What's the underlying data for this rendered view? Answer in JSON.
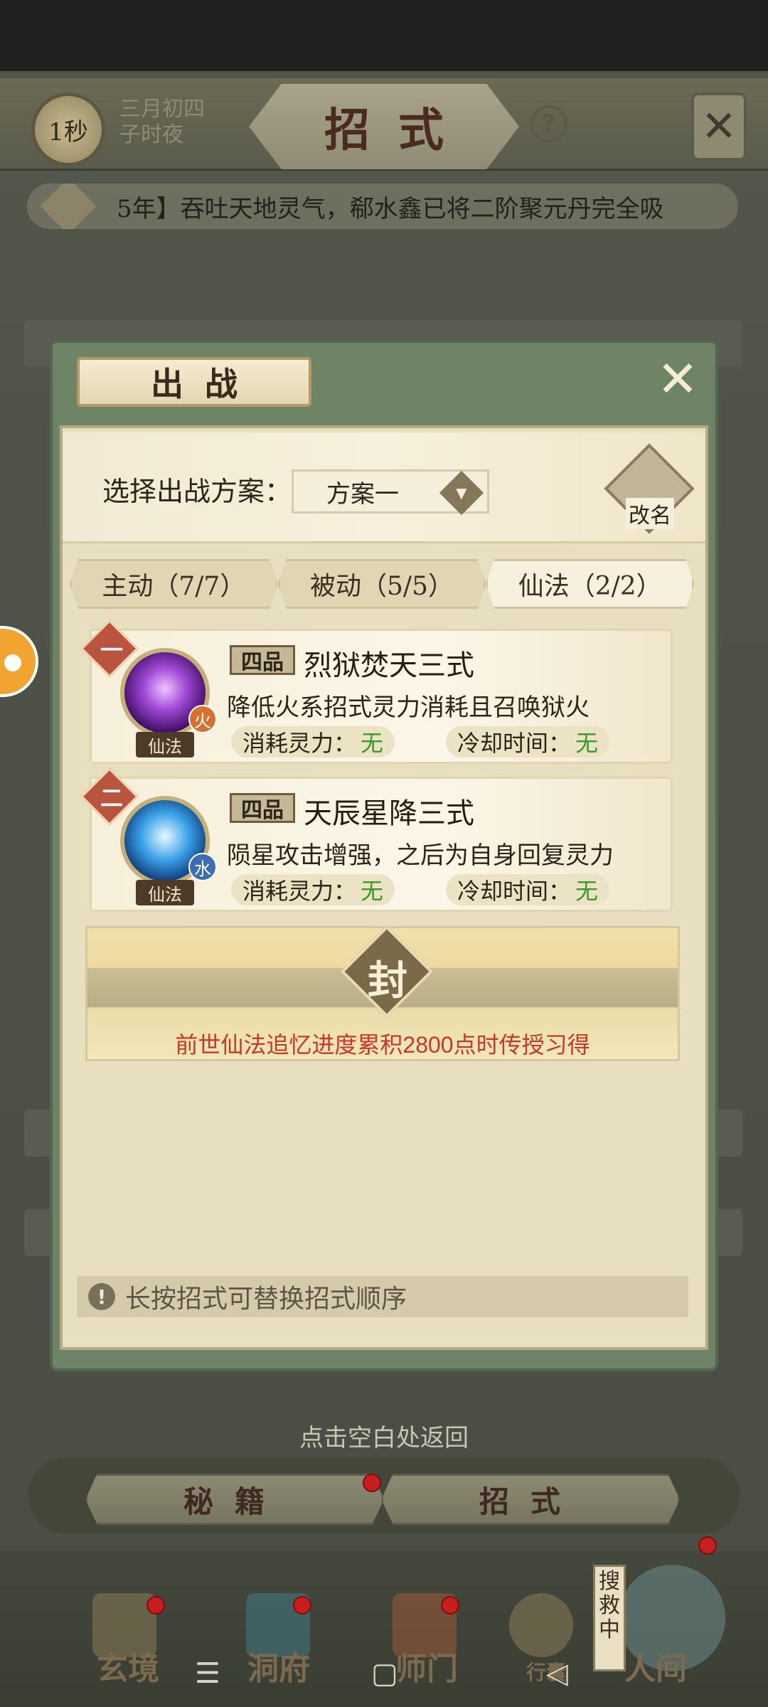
{
  "header": {
    "timer": "1秒",
    "date_line1": "三月初四",
    "date_line2": "子时夜",
    "title": "招式",
    "help_label": "?"
  },
  "ticker": {
    "text": "5年】吞吐天地灵气，郗水鑫已将二阶聚元丹完全吸"
  },
  "modal": {
    "title": "出战",
    "plan_label": "选择出战方案：",
    "plan_value": "方案一",
    "rename_label": "改名",
    "tabs": [
      {
        "label": "主动（7/7）",
        "active": false
      },
      {
        "label": "被动（5/5）",
        "active": false
      },
      {
        "label": "仙法（2/2）",
        "active": true
      }
    ],
    "skills": [
      {
        "rank": "一",
        "grade": "四品",
        "name": "烈狱焚天三式",
        "description": "降低火系招式灵力消耗且召唤狱火",
        "element": "火",
        "type": "仙法",
        "cost_label": "消耗灵力：",
        "cost_value": "无",
        "cooldown_label": "冷却时间：",
        "cooldown_value": "无"
      },
      {
        "rank": "二",
        "grade": "四品",
        "name": "天辰星降三式",
        "description": "陨星攻击增强，之后为自身回复灵力",
        "element": "水",
        "type": "仙法",
        "cost_label": "消耗灵力：",
        "cost_value": "无",
        "cooldown_label": "冷却时间：",
        "cooldown_value": "无"
      }
    ],
    "sealed": {
      "seal_label": "封",
      "text": "前世仙法追忆进度累积2800点时传授习得"
    },
    "hint": "长按招式可替换招式顺序"
  },
  "return_hint": "点击空白处返回",
  "bottom_tabs": [
    "秘籍",
    "招式"
  ],
  "bottom_nav": [
    "玄境",
    "洞府",
    "师门",
    "行囊",
    "人间"
  ],
  "searching_label": "搜救中",
  "colors": {
    "accent_green": "#3a9a2a",
    "warning_red": "#c4392a",
    "modal_frame": "#6f8467"
  }
}
